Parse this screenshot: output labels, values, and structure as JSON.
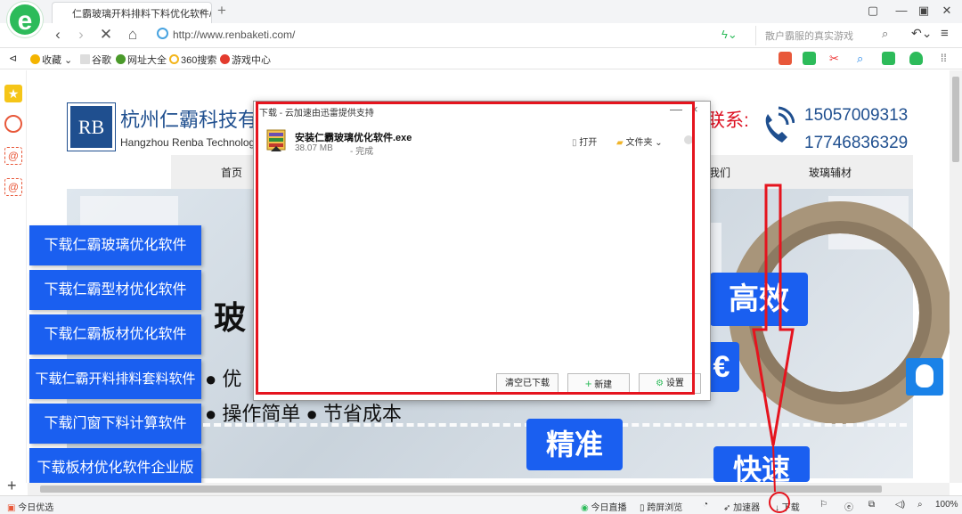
{
  "browser": {
    "logo_letter": "e",
    "tab_title": "仁霸玻璃开料排料下料优化软件/",
    "tab_close": "×",
    "new_tab": "+",
    "url": "http://www.renbaketi.com/",
    "search_placeholder": "散户霸服的真实游戏",
    "window_controls": [
      "restore-icon",
      "minimize-icon",
      "maximize-icon",
      "close-icon"
    ],
    "nav_icons": [
      "back-icon",
      "forward-icon",
      "stop-icon",
      "home-icon"
    ]
  },
  "bookmarks": {
    "items": [
      {
        "label": "收藏",
        "icon": "star-icon",
        "color": "#f4b400"
      },
      {
        "label": "谷歌",
        "icon": "page-icon",
        "color": "#999999"
      },
      {
        "label": "网址大全",
        "icon": "url-icon",
        "color": "#4a9a2a"
      },
      {
        "label": "360搜索",
        "icon": "360-icon",
        "color": "#2dbb5a"
      },
      {
        "label": "游戏中心",
        "icon": "game-icon",
        "color": "#e33b2e"
      }
    ]
  },
  "site": {
    "logo_text": "RB",
    "company_cn": "杭州仁霸科技有",
    "company_en": "Hangzhou Renba Technolog",
    "contact_label": "联系:",
    "phone1": "15057009313",
    "phone2": "17746836329",
    "menu": [
      "首页",
      "我们",
      "玻璃辅材"
    ],
    "download_buttons": [
      "下载仁霸玻璃优化软件",
      "下载仁霸型材优化软件",
      "下载仁霸板材优化软件",
      "下载仁霸开料排料套料软件",
      "下载门窗下料计算软件",
      "下载板材优化软件企业版"
    ],
    "banner_big_char": "玻",
    "feature_line1": "● 优",
    "feature_line2": "● 操作简单 ● 节省成本",
    "tags": [
      "高效",
      "精准",
      "快速"
    ],
    "tag_side": "€"
  },
  "download_dialog": {
    "title": "下载 - 云加速由迅雷提供支持",
    "minimize": "—",
    "close": "×",
    "file_name": "安装仁霸玻璃优化软件.exe",
    "file_size": "38.07 MB",
    "file_status": "- 完成",
    "open_label": "打开",
    "folder_label": "文件夹",
    "clear_label": "清空已下载",
    "new_label": "新建",
    "settings_label": "设置"
  },
  "statusbar": {
    "left_label": "今日优选",
    "items": [
      "今日直播",
      "跨屏浏览",
      "加速器",
      "下载"
    ],
    "zoom": "100%"
  },
  "sidebar": {
    "icons": [
      "favorite-star-icon",
      "weibo-icon",
      "mail-icon",
      "mail-icon-2"
    ]
  },
  "colors": {
    "accent_green": "#2dbb5a",
    "brand_blue": "#1a5ff0",
    "annotation_red": "#e5141e"
  }
}
